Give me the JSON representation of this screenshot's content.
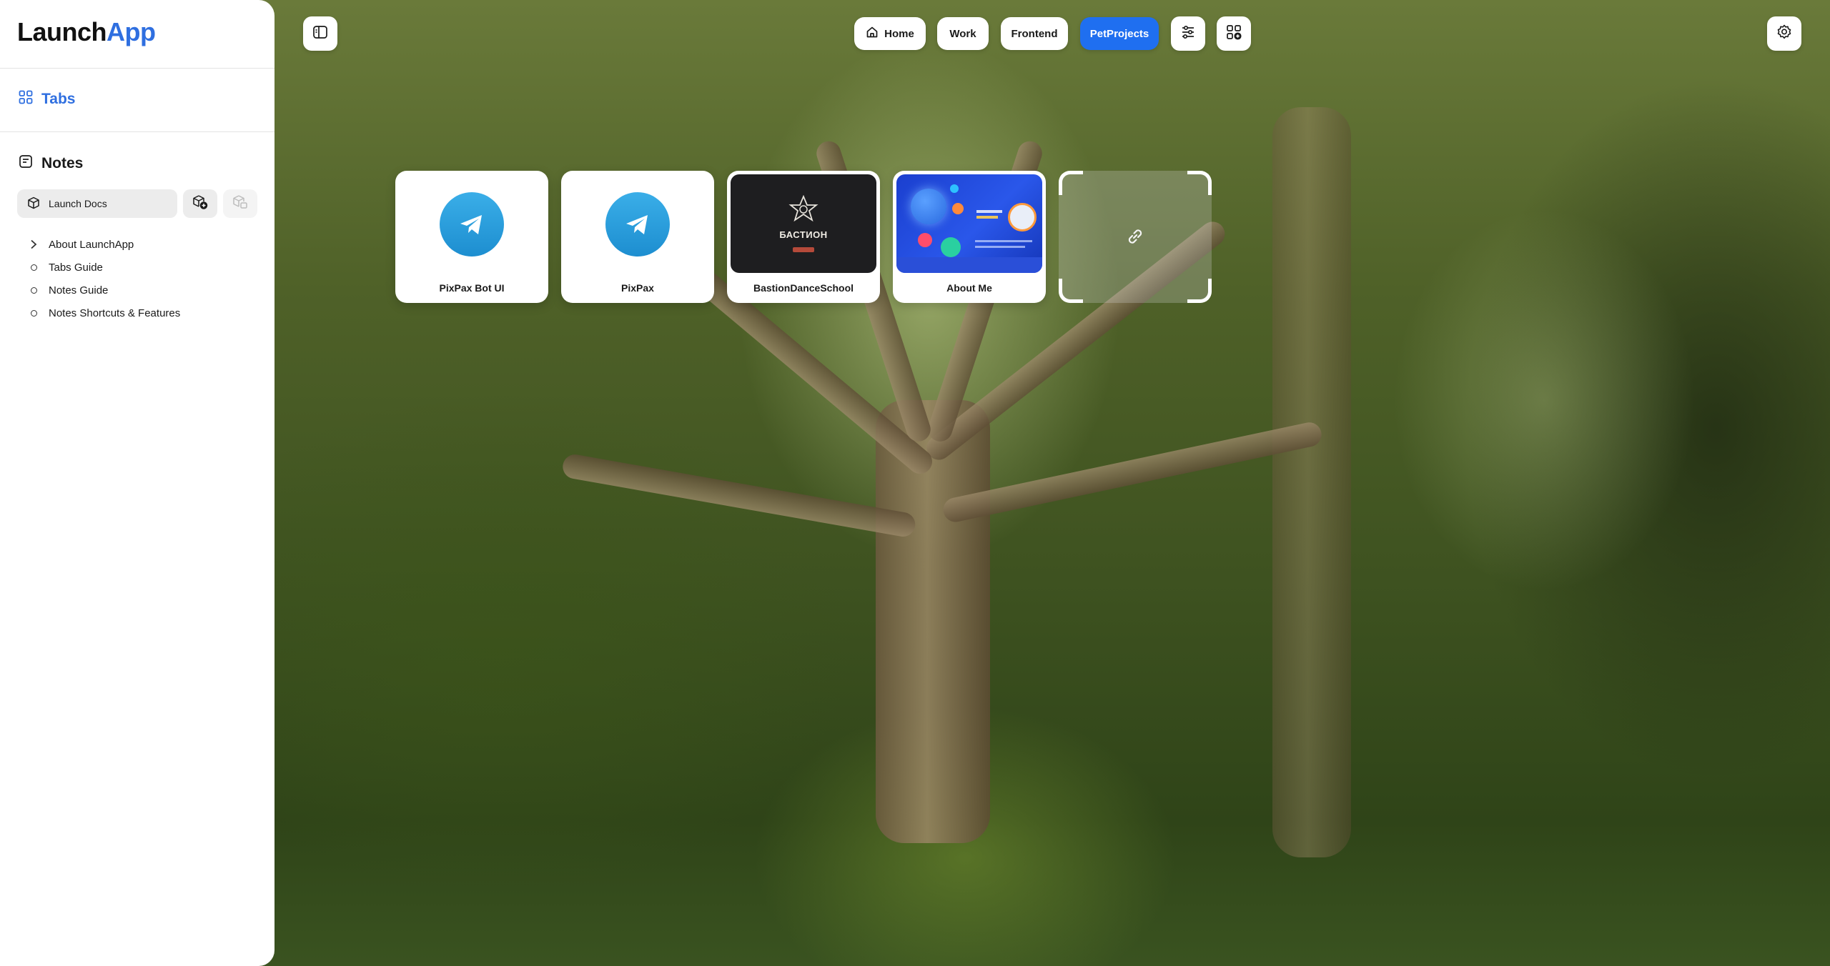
{
  "app": {
    "logo_main": "Launch",
    "logo_accent": "App",
    "accent_color": "#2f6fe0"
  },
  "sidebar": {
    "tabs_label": "Tabs",
    "notes_label": "Notes",
    "doc_selector": "Launch Docs",
    "tree": [
      {
        "label": "About LaunchApp",
        "marker": "chevron-right-icon"
      },
      {
        "label": "Tabs Guide",
        "marker": "circle-icon"
      },
      {
        "label": "Notes Guide",
        "marker": "circle-icon"
      },
      {
        "label": "Notes Shortcuts & Features",
        "marker": "circle-icon"
      }
    ]
  },
  "topbar": {
    "groups": [
      {
        "label": "Home",
        "icon": "home-icon",
        "active": false
      },
      {
        "label": "Work",
        "active": false
      },
      {
        "label": "Frontend",
        "active": false
      },
      {
        "label": "PetProjects",
        "active": true
      }
    ],
    "active_color": "#1f6ff0"
  },
  "cards": [
    {
      "label": "PixPax Bot UI",
      "thumbnail": "telegram-icon"
    },
    {
      "label": "PixPax",
      "thumbnail": "telegram-icon"
    },
    {
      "label": "BastionDanceSchool",
      "thumbnail": "website-screenshot",
      "thumb_text": "БАСТИОН"
    },
    {
      "label": "About Me",
      "thumbnail": "website-screenshot"
    }
  ],
  "add_card": {
    "icon": "link-icon"
  }
}
